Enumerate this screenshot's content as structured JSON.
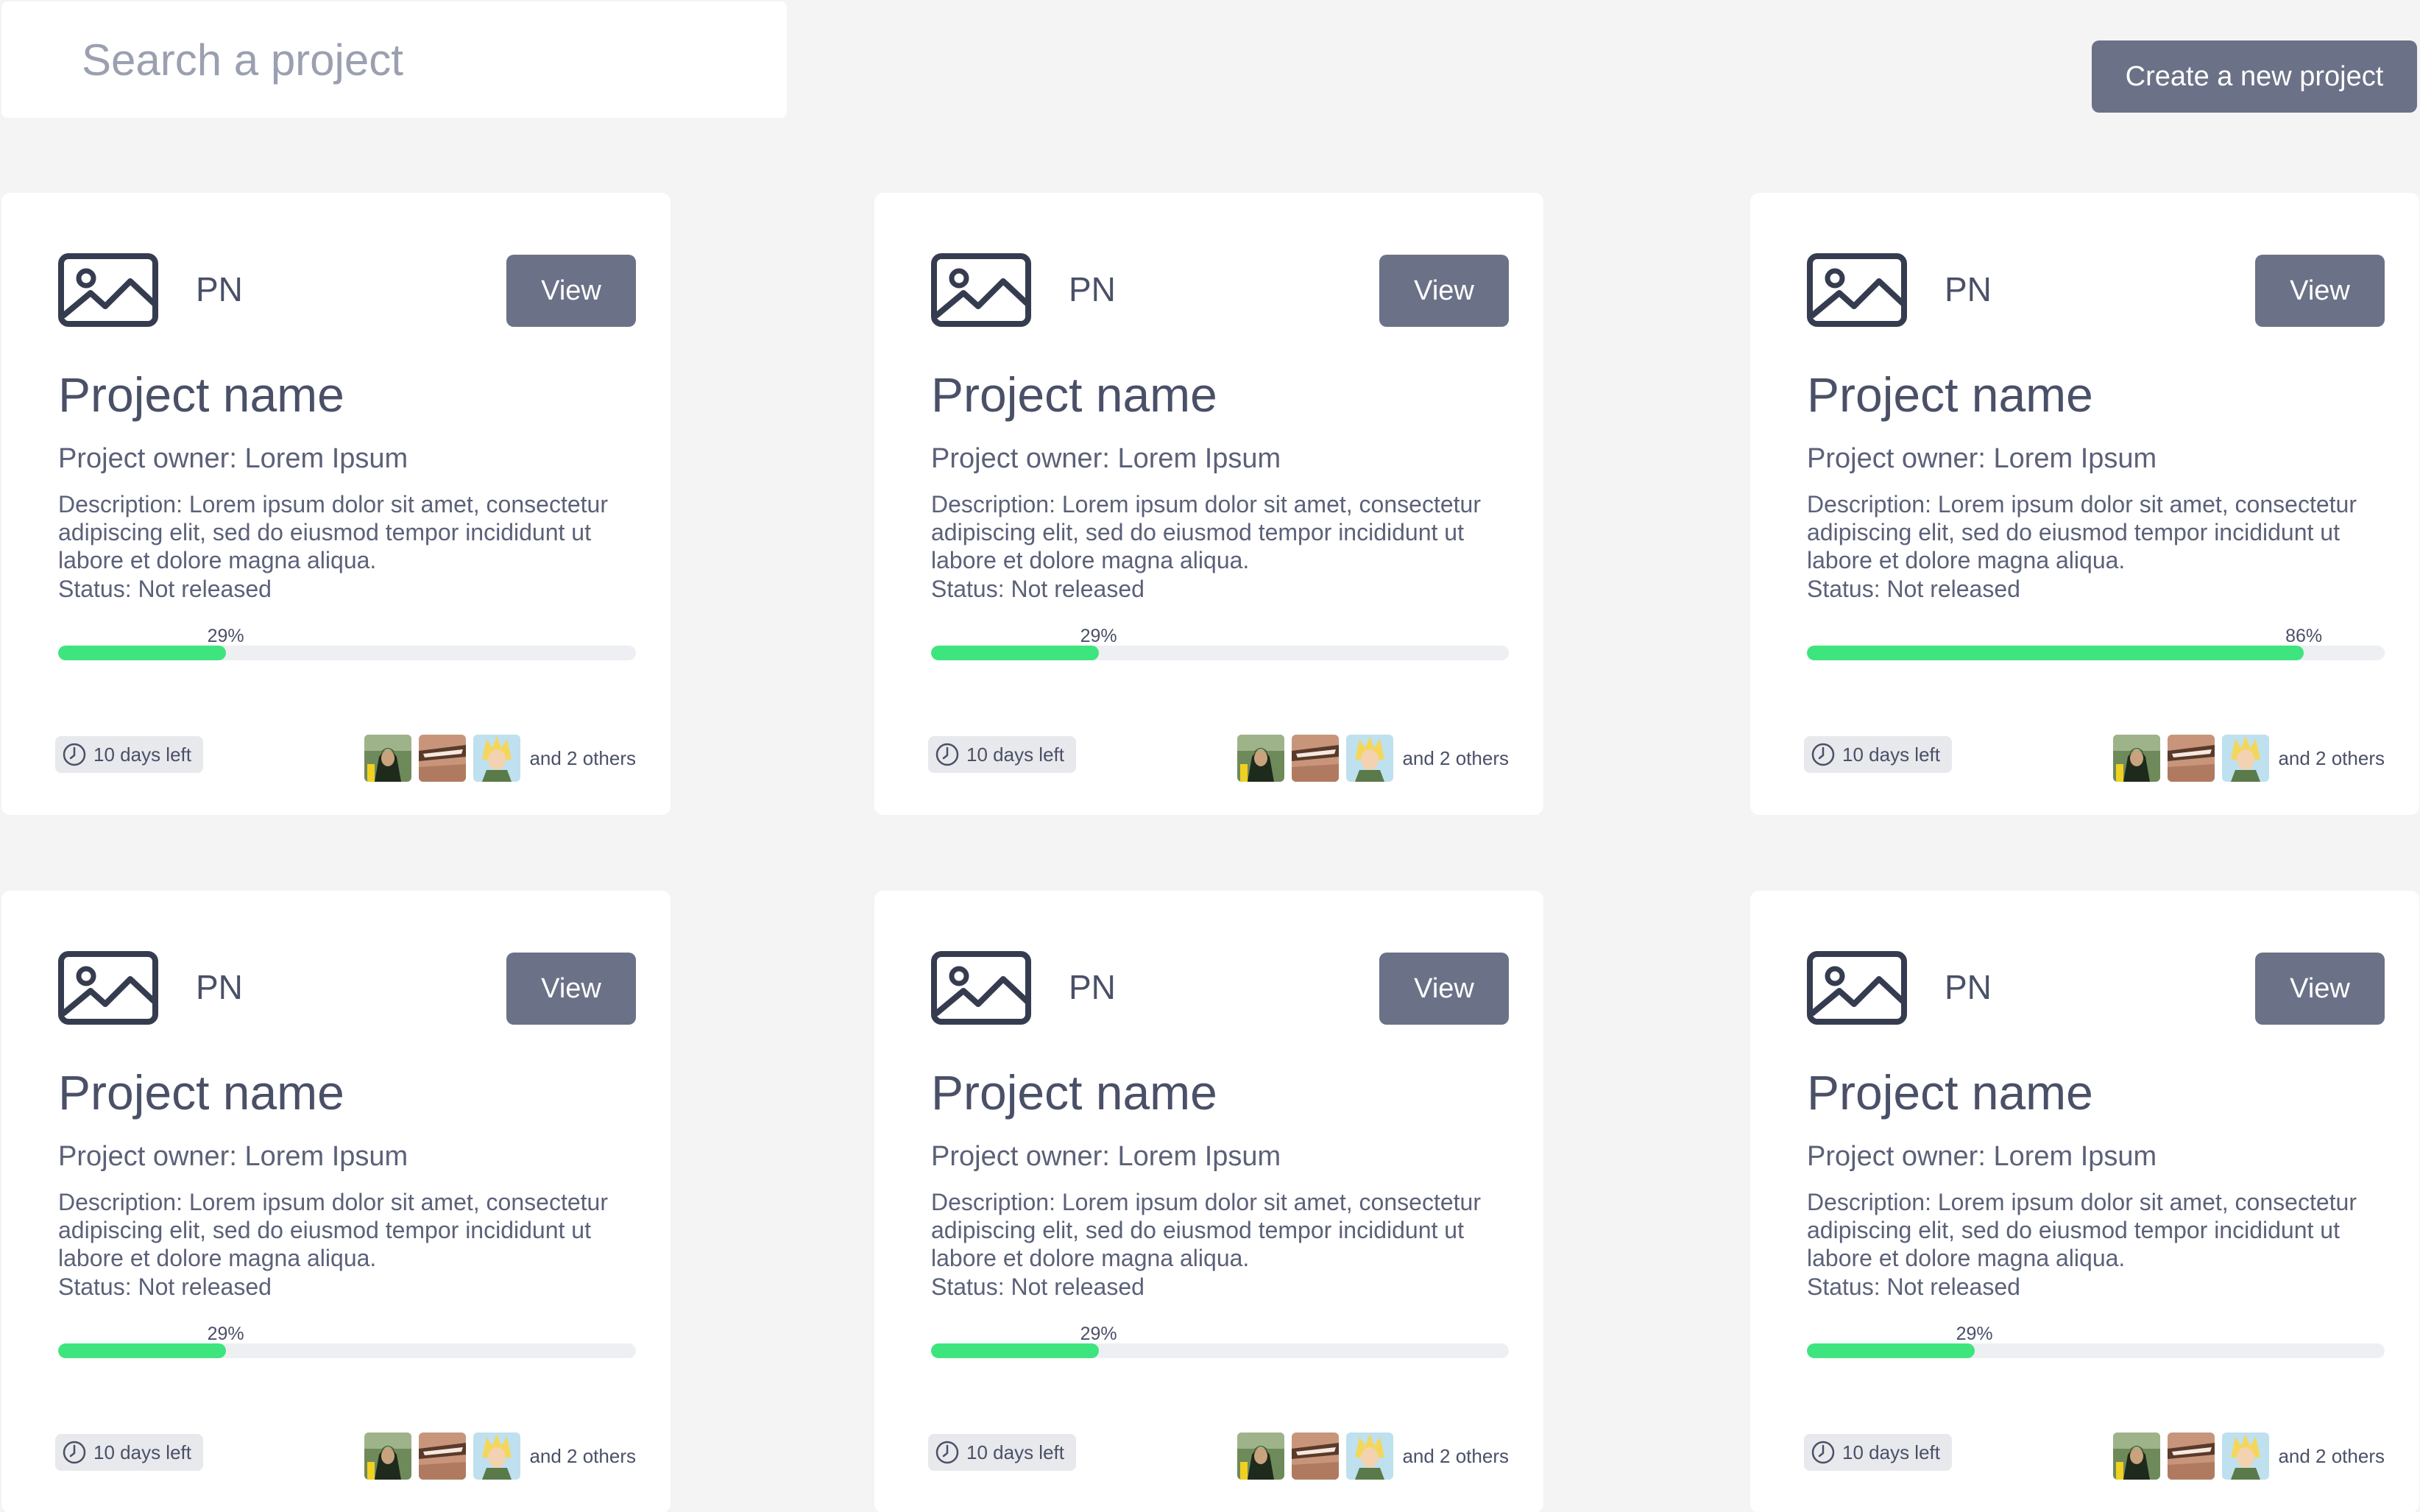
{
  "search": {
    "placeholder": "Search a project",
    "value": ""
  },
  "header": {
    "create_label": "Create a new project"
  },
  "colors": {
    "accent": "#6b7187",
    "progress": "#3ee57e",
    "background": "#f4f4f4",
    "card": "#ffffff"
  },
  "projects": [
    {
      "initials": "PN",
      "view_label": "View",
      "name": "Project name",
      "owner": "Project owner: Lorem Ipsum",
      "description": "Description: Lorem ipsum dolor sit amet, consectetur adipiscing elit, sed do eiusmod tempor incididunt ut labore et dolore magna aliqua.",
      "status": "Status: Not released",
      "progress": 29,
      "progress_label": "29%",
      "days_left": "10 days left",
      "others": "and 2 others"
    },
    {
      "initials": "PN",
      "view_label": "View",
      "name": "Project name",
      "owner": "Project owner: Lorem Ipsum",
      "description": "Description: Lorem ipsum dolor sit amet, consectetur adipiscing elit, sed do eiusmod tempor incididunt ut labore et dolore magna aliqua.",
      "status": "Status: Not released",
      "progress": 29,
      "progress_label": "29%",
      "days_left": "10 days left",
      "others": "and 2 others"
    },
    {
      "initials": "PN",
      "view_label": "View",
      "name": "Project name",
      "owner": "Project owner: Lorem Ipsum",
      "description": "Description: Lorem ipsum dolor sit amet, consectetur adipiscing elit, sed do eiusmod tempor incididunt ut labore et dolore magna aliqua.",
      "status": "Status: Not released",
      "progress": 86,
      "progress_label": "86%",
      "days_left": "10 days left",
      "others": "and 2 others"
    },
    {
      "initials": "PN",
      "view_label": "View",
      "name": "Project name",
      "owner": "Project owner: Lorem Ipsum",
      "description": "Description: Lorem ipsum dolor sit amet, consectetur adipiscing elit, sed do eiusmod tempor incididunt ut labore et dolore magna aliqua.",
      "status": "Status: Not released",
      "progress": 29,
      "progress_label": "29%",
      "days_left": "10 days left",
      "others": "and 2 others"
    },
    {
      "initials": "PN",
      "view_label": "View",
      "name": "Project name",
      "owner": "Project owner: Lorem Ipsum",
      "description": "Description: Lorem ipsum dolor sit amet, consectetur adipiscing elit, sed do eiusmod tempor incididunt ut labore et dolore magna aliqua.",
      "status": "Status: Not released",
      "progress": 29,
      "progress_label": "29%",
      "days_left": "10 days left",
      "others": "and 2 others"
    },
    {
      "initials": "PN",
      "view_label": "View",
      "name": "Project name",
      "owner": "Project owner: Lorem Ipsum",
      "description": "Description: Lorem ipsum dolor sit amet, consectetur adipiscing elit, sed do eiusmod tempor incididunt ut labore et dolore magna aliqua.",
      "status": "Status: Not released",
      "progress": 29,
      "progress_label": "29%",
      "days_left": "10 days left",
      "others": "and 2 others"
    }
  ]
}
